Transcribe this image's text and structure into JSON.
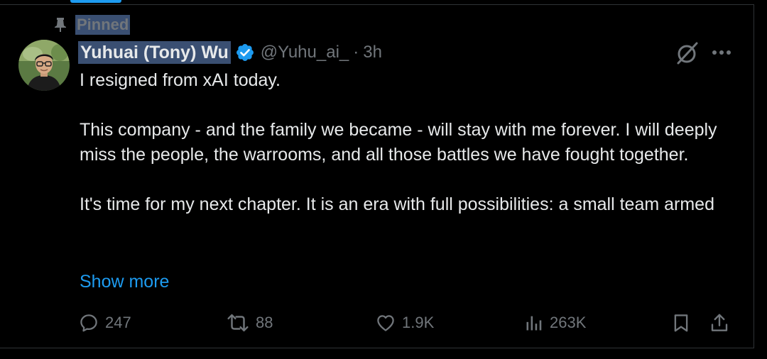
{
  "pinned": {
    "label": "Pinned"
  },
  "author": {
    "display_name": "Yuhuai (Tony) Wu",
    "handle": "@Yuhu_ai_",
    "separator": "·",
    "time": "3h",
    "verified": true
  },
  "tweet": {
    "paragraphs": [
      "I resigned from xAI today.",
      "This company - and the family we became - will stay with me forever. I will deeply miss the people, the warrooms, and all those battles we have fought together.",
      "It's time for my next chapter. It is an era with full possibilities: a small team armed"
    ],
    "show_more": "Show more"
  },
  "actions": {
    "replies": "247",
    "reposts": "88",
    "likes": "1.9K",
    "views": "263K"
  },
  "colors": {
    "background": "#000000",
    "text": "#e7e9ea",
    "muted": "#71767b",
    "accent": "#1d9bf0",
    "selection": "#3a4f72",
    "border": "#2f3336"
  },
  "icons": [
    "pin-icon",
    "verified-badge-icon",
    "grok-icon",
    "more-icon",
    "reply-icon",
    "repost-icon",
    "like-icon",
    "views-icon",
    "bookmark-icon",
    "share-icon"
  ]
}
